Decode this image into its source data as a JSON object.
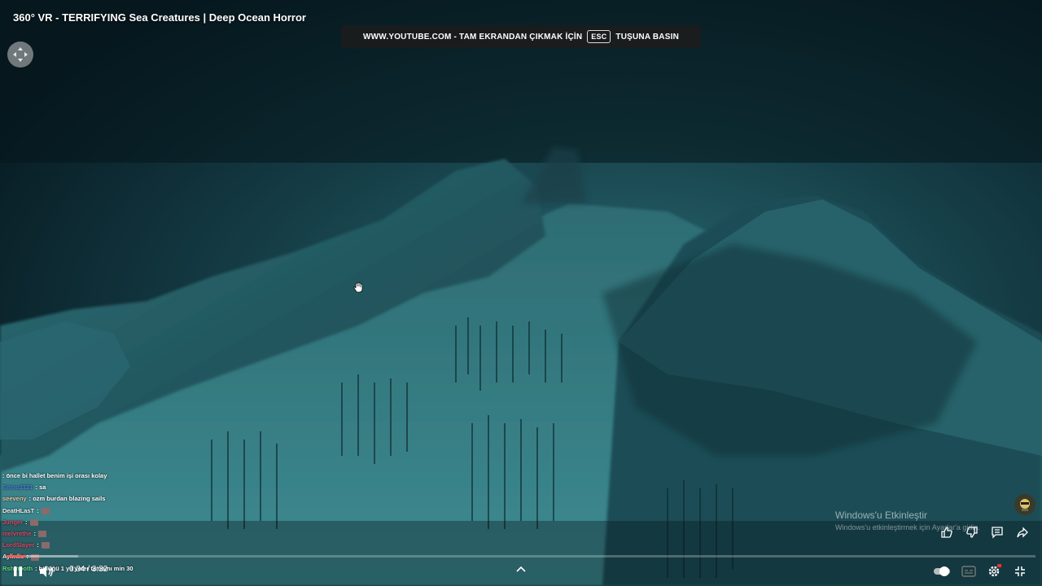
{
  "video": {
    "title": "360° VR - TERRIFYING Sea Creatures | Deep Ocean Horror",
    "current_time": "0:04",
    "duration": "3:32",
    "time_display": "0:04 / 3:32",
    "progress_fraction": 0.019,
    "buffered_fraction": 0.07
  },
  "fullscreen_banner": {
    "text_before": "WWW.YOUTUBE.COM - TAM EKRANDAN ÇIKMAK İÇİN",
    "key": "ESC",
    "text_after": "TUŞUNA BASIN"
  },
  "chat": [
    {
      "user": "",
      "message": ""
    },
    {
      "user": "",
      "message": ": önce bi hallet benim işi orası kolay",
      "user_color": "#e14b6a"
    },
    {
      "user": "Emoo2121",
      "message": ": sa",
      "user_color": "#4a7fe0"
    },
    {
      "user": "seeveny",
      "message": ": ozm burdan blazing sails",
      "user_color": "#e8c7a0"
    },
    {
      "user": "DeatHLasT",
      "message": ":",
      "user_color": "#f0f0f0"
    },
    {
      "user": "Junger",
      "message": ":",
      "user_color": "#e14b6a"
    },
    {
      "user": "melvrethe",
      "message": ":",
      "user_color": "#e14b6a"
    },
    {
      "user": "LordSlayer",
      "message": ":",
      "user_color": "#e14b6a"
    },
    {
      "user": "",
      "message": ""
    },
    {
      "user": "Aylinlie",
      "message": ":",
      "user_color": "#f0f0f0"
    },
    {
      "user": "Rshmooth",
      "message": ": bülüğü 1 yıl yeter tamamı min 30",
      "user_color": "#5ce08a"
    }
  ],
  "watermark": {
    "title": "Windows'u Etkinleştir",
    "subtitle": "Windows'u etkinleştirmek için Ayarlar'a gidin."
  },
  "colors": {
    "progress": "#ff0000",
    "water_deep": "#071a22",
    "water_light": "#2f7f86"
  },
  "icons": [
    "vr-navigation-icon",
    "hand-cursor-icon",
    "like-icon",
    "dislike-icon",
    "comment-icon",
    "share-icon",
    "play-pause-icon",
    "volume-icon",
    "chevron-up-icon",
    "autoplay-toggle-icon",
    "subtitles-icon",
    "settings-icon",
    "exit-fullscreen-icon"
  ]
}
